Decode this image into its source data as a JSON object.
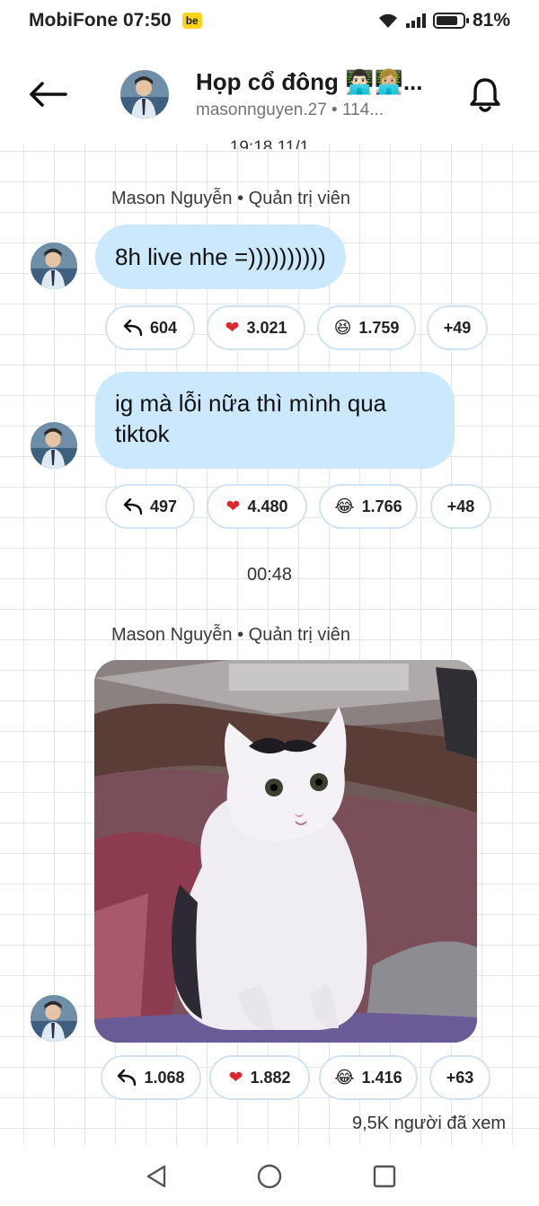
{
  "status_bar": {
    "carrier_time": "MobiFone 07:50",
    "badge": "be",
    "battery": "81%",
    "battery_level": 0.81
  },
  "header": {
    "title": "Họp cổ đông 👨🏻‍💻👩🏼‍💻...",
    "subtitle": "masonnguyen.27 • 114...",
    "back_icon": "arrow-left-icon",
    "bell_icon": "bell-icon"
  },
  "chat": {
    "clipped_time": "19:18 11/1",
    "group1": {
      "sender": "Mason Nguyễn • Quản trị viên",
      "messages": [
        {
          "text": "8h live nhe =))))))))))",
          "reactions": {
            "reply": "604",
            "heart": "3.021",
            "laugh": "1.759",
            "more": "+49"
          }
        },
        {
          "text": "ig mà lỗi nữa thì mình qua tiktok",
          "reactions": {
            "reply": "497",
            "heart": "4.480",
            "laugh": "1.766",
            "more": "+48"
          }
        }
      ]
    },
    "time_separator": "00:48",
    "group2": {
      "sender": "Mason Nguyễn • Quản trị viên",
      "image_alt": "cat-photo",
      "reactions": {
        "reply": "1.068",
        "heart": "1.882",
        "laugh": "1.416",
        "more": "+63"
      }
    },
    "views": "9,5K người đã xem"
  },
  "colors": {
    "bubble": "#cbe8fd",
    "pill_border": "#cfe3f4",
    "grid": "#e3e5ea"
  }
}
